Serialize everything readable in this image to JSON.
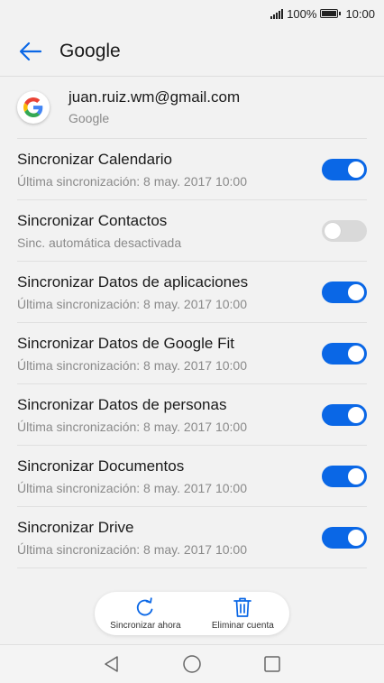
{
  "status": {
    "battery_percent": "100%",
    "time": "10:00"
  },
  "appbar": {
    "title": "Google"
  },
  "account": {
    "email": "juan.ruiz.wm@gmail.com",
    "type": "Google"
  },
  "sync_items": [
    {
      "title": "Sincronizar Calendario",
      "subtitle": "Última sincronización: 8 may. 2017 10:00",
      "enabled": true
    },
    {
      "title": "Sincronizar Contactos",
      "subtitle": "Sinc. automática desactivada",
      "enabled": false
    },
    {
      "title": "Sincronizar Datos de aplicaciones",
      "subtitle": "Última sincronización: 8 may. 2017 10:00",
      "enabled": true
    },
    {
      "title": "Sincronizar Datos de Google Fit",
      "subtitle": "Última sincronización: 8 may. 2017 10:00",
      "enabled": true
    },
    {
      "title": "Sincronizar Datos de personas",
      "subtitle": "Última sincronización: 8 may. 2017 10:00",
      "enabled": true
    },
    {
      "title": "Sincronizar Documentos",
      "subtitle": "Última sincronización: 8 may. 2017 10:00",
      "enabled": true
    },
    {
      "title": "Sincronizar Drive",
      "subtitle": "Última sincronización: 8 may. 2017 10:00",
      "enabled": true
    }
  ],
  "actions": {
    "sync_now": "Sincronizar ahora",
    "remove_account": "Eliminar cuenta"
  },
  "colors": {
    "accent": "#0a67e6",
    "switch_off": "#d9d9d9"
  },
  "icons": {
    "back": "arrow-left-icon",
    "sync": "refresh-icon",
    "delete": "trash-icon",
    "nav_back": "triangle-back-icon",
    "nav_home": "circle-home-icon",
    "nav_recent": "square-recent-icon"
  }
}
